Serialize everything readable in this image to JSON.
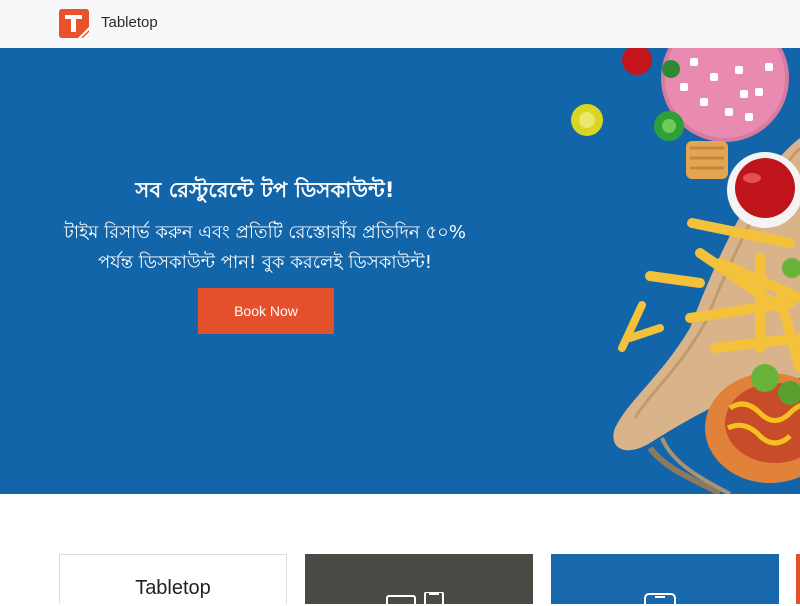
{
  "header": {
    "brand": "Tabletop",
    "logo_icon": "tabletop-logo-icon",
    "logo_color": "#e8532e"
  },
  "hero": {
    "title": "সব রেস্টুরেন্টে টপ ডিসকাউন্ট!",
    "subtitle_line1": "টাইম রিসার্ভ করুন এবং প্রতিটি রেস্তোরাঁয় প্রতিদিন ৫০%",
    "subtitle_line2": "পর্যন্ত ডিসকাউন্ট পান! বুক করলেই ডিসকাউন্ট!",
    "button_label": "Book Now",
    "background_color": "#1365aa",
    "button_color": "#e4502b"
  },
  "cards": [
    {
      "label": "Tabletop",
      "icon": ""
    },
    {
      "label": "",
      "icon": "tablet-icon"
    },
    {
      "label": "",
      "icon": "phone-icon"
    },
    {
      "label": "",
      "icon": ""
    }
  ]
}
